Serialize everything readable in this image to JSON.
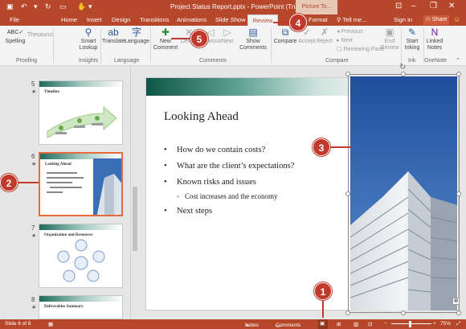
{
  "window": {
    "title": "Project Status Report.pptx - PowerPoint (Trial)",
    "context_tab": "Picture To...",
    "context_sub": "Format"
  },
  "tabs": {
    "file": "File",
    "home": "Home",
    "insert": "Insert",
    "design": "Design",
    "transitions": "Transitions",
    "animations": "Animations",
    "slideshow": "Slide Show",
    "review": "Review",
    "tell": "Tell me...",
    "signin": "Sign in",
    "share": "Share"
  },
  "ribbon": {
    "spelling": "Spelling",
    "thesaurus": "Thesaurus",
    "proofing": "Proofing",
    "smart": "Smart",
    "lookup": "Lookup",
    "insights": "Insights",
    "translate": "Translate",
    "language": "Language",
    "language_group": "Language",
    "new_comment_1": "New",
    "new_comment_2": "Comment",
    "delete": "Delete",
    "previous": "Previous",
    "next": "Next",
    "show_comments_1": "Show",
    "show_comments_2": "Comments",
    "comments_group": "Comments",
    "compare": "Compare",
    "accept": "Accept",
    "reject": "Reject",
    "prev2": "Previous",
    "next2": "Next",
    "reviewing_pane": "Reviewing Pane",
    "end_review_1": "End",
    "end_review_2": "Review",
    "compare_group": "Compare",
    "start_inking_1": "Start",
    "start_inking_2": "Inking",
    "ink_group": "Ink",
    "linked_notes_1": "Linked",
    "linked_notes_2": "Notes",
    "onenote_group": "OneNote"
  },
  "thumbnails": [
    {
      "num": "5",
      "title": "Timeline"
    },
    {
      "num": "6",
      "title": "Looking Ahead"
    },
    {
      "num": "7",
      "title": "Organization and Resources"
    },
    {
      "num": "8",
      "title": "Deliverables Summary"
    }
  ],
  "slide": {
    "title": "Looking Ahead",
    "bullets": [
      "How do we contain costs?",
      "What are the client’s expectations?",
      "Known risks and issues"
    ],
    "sub_bullet": "Cost increases and the economy",
    "last_bullet": "Next steps"
  },
  "status": {
    "slide": "Slide 6 of 8",
    "notes": "Notes",
    "comments": "Comments",
    "zoom": "75%"
  },
  "callouts": {
    "c1": "1",
    "c2": "2",
    "c3": "3",
    "c4": "4",
    "c5": "5"
  },
  "colors": {
    "accent": "#b7472a",
    "callout": "#c0392b"
  }
}
